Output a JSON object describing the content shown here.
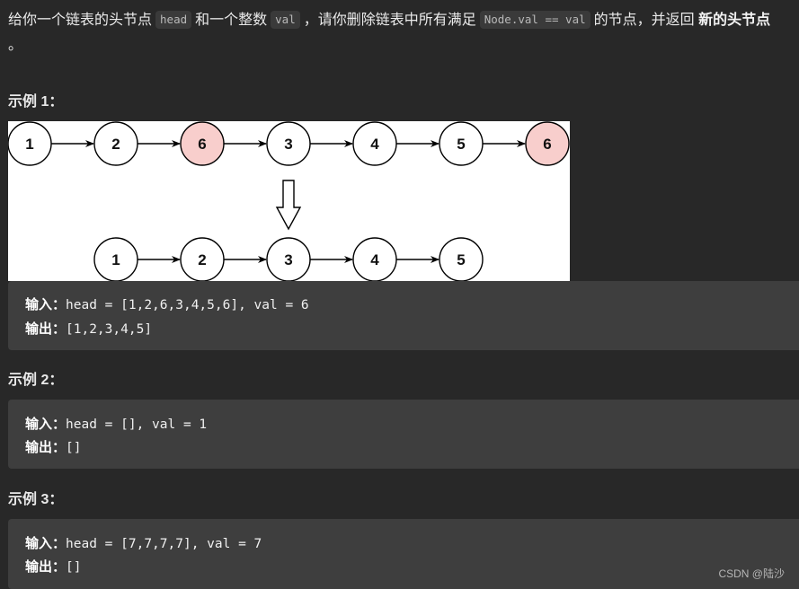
{
  "description": {
    "part1": "给你一个链表的头节点",
    "code1": "head",
    "part2": "和一个整数",
    "code2": "val",
    "part3": "，请你删除链表中所有满足",
    "code3": "Node.val == val",
    "part4": "的节点，并返回",
    "bold": "新的头节点",
    "period": "。"
  },
  "examples": [
    {
      "title": "示例 1：",
      "input_label": "输入：",
      "input": "head = [1,2,6,3,4,5,6], val = 6",
      "output_label": "输出：",
      "output": "[1,2,3,4,5]"
    },
    {
      "title": "示例 2：",
      "input_label": "输入：",
      "input": "head = [], val = 1",
      "output_label": "输出：",
      "output": "[]"
    },
    {
      "title": "示例 3：",
      "input_label": "输入：",
      "input": "head = [7,7,7,7], val = 7",
      "output_label": "输出：",
      "output": "[]"
    }
  ],
  "diagram": {
    "before": [
      {
        "label": "1",
        "removed": false
      },
      {
        "label": "2",
        "removed": false
      },
      {
        "label": "6",
        "removed": true
      },
      {
        "label": "3",
        "removed": false
      },
      {
        "label": "4",
        "removed": false
      },
      {
        "label": "5",
        "removed": false
      },
      {
        "label": "6",
        "removed": true
      }
    ],
    "after": [
      {
        "label": "1"
      },
      {
        "label": "2"
      },
      {
        "label": "3"
      },
      {
        "label": "4"
      },
      {
        "label": "5"
      }
    ],
    "colors": {
      "removed_fill": "#f8cecc",
      "node_fill": "#ffffff",
      "stroke": "#000000"
    }
  },
  "watermark": "CSDN @陆沙"
}
